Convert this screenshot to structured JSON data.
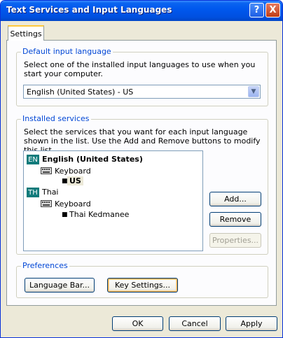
{
  "window": {
    "title": "Text Services and Input Languages",
    "help_label": "?",
    "close_label": "X"
  },
  "tabs": [
    {
      "label": "Settings",
      "selected": true
    }
  ],
  "default_input": {
    "group_title": "Default input language",
    "description": "Select one of the installed input languages to use when you start your computer.",
    "selected_value": "English (United States) - US"
  },
  "installed_services": {
    "group_title": "Installed services",
    "description": "Select the services that you want for each input language shown in the list. Use the Add and Remove buttons to modify this list.",
    "languages": [
      {
        "badge": "EN",
        "name": "English (United States)",
        "service": "Keyboard",
        "layout": "US"
      },
      {
        "badge": "TH",
        "name": "Thai",
        "service": "Keyboard",
        "layout": "Thai Kedmanee"
      }
    ],
    "buttons": {
      "add": "Add...",
      "remove": "Remove",
      "properties": "Properties..."
    }
  },
  "preferences": {
    "group_title": "Preferences",
    "language_bar": "Language Bar...",
    "key_settings": "Key Settings..."
  },
  "footer": {
    "ok": "OK",
    "cancel": "Cancel",
    "apply": "Apply"
  },
  "colors": {
    "accent": "#0046D5",
    "badge": "#0F7B7B",
    "titlebar": "#0058EE"
  }
}
